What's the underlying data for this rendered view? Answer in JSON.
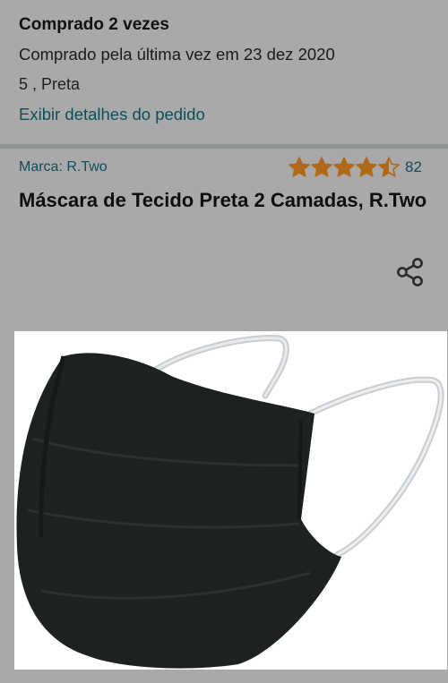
{
  "order": {
    "bought_times": "Comprado 2 vezes",
    "last_bought": "Comprado pela última vez em 23 dez 2020",
    "variant": "5 , Preta",
    "details_link": "Exibir detalhes do pedido"
  },
  "product": {
    "brand": "Marca: R.Two",
    "rating_count": "82",
    "rating_value": 4.5,
    "title": "Máscara de Tecido Preta 2 Camadas, R.Two",
    "share_icon": "share-icon",
    "image_alt": "black-fabric-face-mask"
  },
  "colors": {
    "background": "#a9a9a9",
    "link": "#0d4f5c",
    "star": "#b0691a",
    "divider": "#8d9393"
  }
}
